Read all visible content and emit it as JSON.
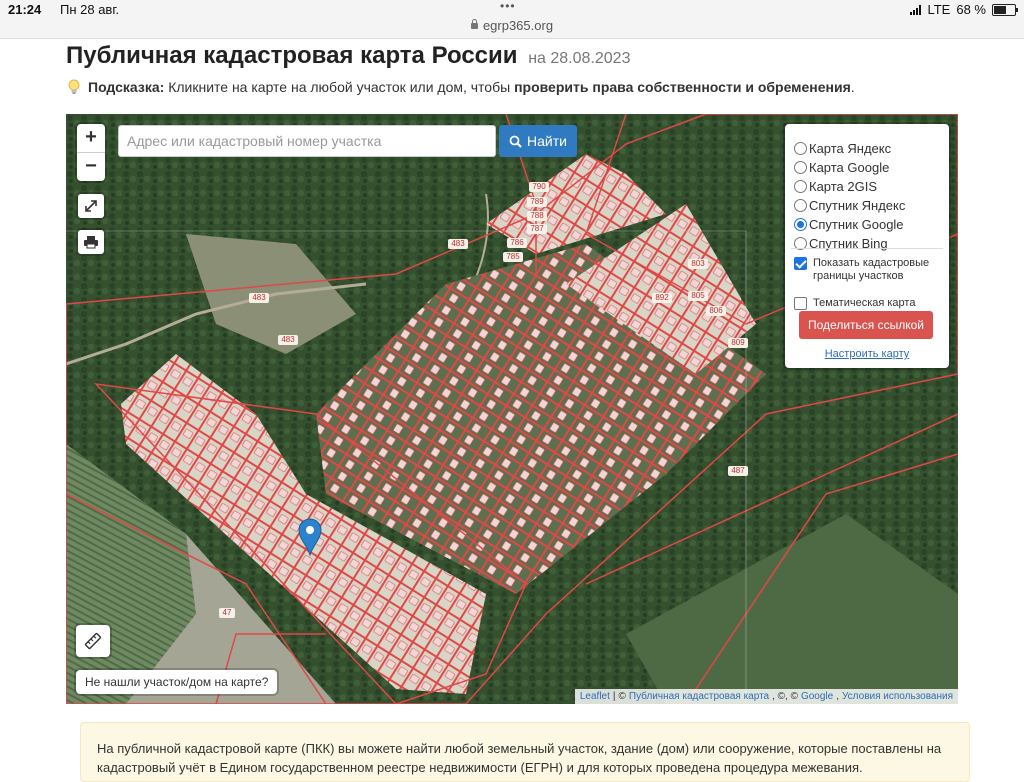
{
  "status_bar": {
    "time": "21:24",
    "date": "Пн 28 авг.",
    "url": "egrp365.org",
    "network": "LTE",
    "battery": "68 %",
    "battery_level": 0.68
  },
  "header": {
    "title": "Публичная кадастровая карта России",
    "date_suffix": "на 28.08.2023"
  },
  "hint": {
    "label": "Подсказка:",
    "text": "Кликните на карте на любой участок или дом, чтобы",
    "bold_text": "проверить права собственности и обременения",
    "end": "."
  },
  "map": {
    "zoom_in": "+",
    "zoom_out": "−",
    "search_placeholder": "Адрес или кадастровый номер участка",
    "search_value": "",
    "find_button": "Найти",
    "layers": [
      {
        "label": "Карта Яндекс",
        "selected": false
      },
      {
        "label": "Карта Google",
        "selected": false
      },
      {
        "label": "Карта 2GIS",
        "selected": false
      },
      {
        "label": "Спутник Яндекс",
        "selected": false
      },
      {
        "label": "Спутник Google",
        "selected": true
      },
      {
        "label": "Спутник Bing",
        "selected": false
      }
    ],
    "show_boundaries": {
      "label": "Показать кадастровые границы участков",
      "checked": true
    },
    "thematic_map": {
      "label": "Тематическая карта",
      "checked": false
    },
    "share_button": "Поделиться ссылкой",
    "configure_link": "Настроить карту",
    "not_found_button": "Не нашли участок/дом на карте?",
    "attribution": {
      "leaflet": "Leaflet",
      "sep1": "|",
      "copy1": "©",
      "pkk": "Публичная кадастровая карта",
      "sep2": ", ©, ©",
      "google": "Google",
      "sep3": ",",
      "terms": "Условия использования"
    },
    "parcel_labels": [
      "483",
      "483",
      "483",
      "487",
      "47",
      "790",
      "789",
      "788",
      "787",
      "786",
      "785",
      "803",
      "805",
      "806",
      "809",
      "892"
    ]
  },
  "info": {
    "text": "На публичной кадастровой карте (ПКК) вы можете найти любой земельный участок, здание (дом) или сооружение, которые поставлены на кадастровый учёт в Едином государственном реестре недвижимости (ЕГРН) и для которых проведена процедура межевания."
  },
  "colors": {
    "find_button": "#2f7ac0",
    "share_button": "#d9534f",
    "parcel_border": "#e04848",
    "link": "#2f6db5",
    "info_bg": "#fcf8e3"
  }
}
